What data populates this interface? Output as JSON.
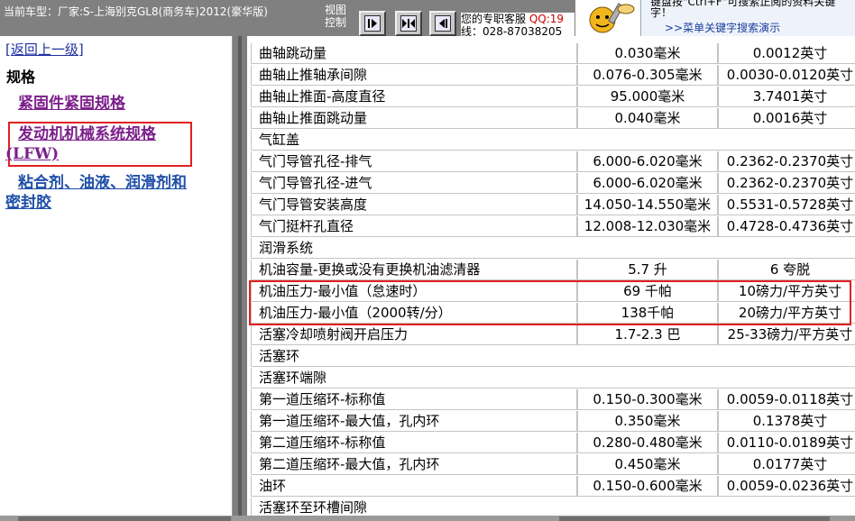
{
  "header": {
    "vehicle_label": "当前车型：厂家:S-上海别克GL8(商务车)2012(豪华版)",
    "view_control_label": "视图控制",
    "nav_buttons": [
      "first",
      "expand",
      "previous"
    ],
    "support_label": "您的专职客服",
    "support_qq": "QQ:19",
    "support_phone": "线：028-87038205",
    "tips_line1": "键盘按\"Ctrl+F\"可搜索正阅的资料关键",
    "tips_line2": "字！",
    "tips_link": ">>菜单关键字搜索演示"
  },
  "sidebar": {
    "back_link": "[返回上一级]",
    "section_title": "规格",
    "items": [
      {
        "label": "紧固件紧固规格"
      },
      {
        "label_line1": "发动机机械系统规格",
        "label_line2": "(LFW)"
      },
      {
        "label_line1": "粘合剂、油液、润滑剂和",
        "label_line2": "密封胶"
      }
    ]
  },
  "table": {
    "rows": [
      {
        "name": "曲轴跳动量",
        "metric": "0.030毫米",
        "imperial": "0.0012英寸"
      },
      {
        "name": "曲轴止推轴承间隙",
        "metric": "0.076-0.305毫米",
        "imperial": "0.0030-0.0120英寸"
      },
      {
        "name": "曲轴止推面-高度直径",
        "metric": "95.000毫米",
        "imperial": "3.7401英寸"
      },
      {
        "name": "曲轴止推面跳动量",
        "metric": "0.040毫米",
        "imperial": "0.0016英寸"
      },
      {
        "name": "气缸盖",
        "section": true
      },
      {
        "name": "气门导管孔径-排气",
        "metric": "6.000-6.020毫米",
        "imperial": "0.2362-0.2370英寸"
      },
      {
        "name": "气门导管孔径-进气",
        "metric": "6.000-6.020毫米",
        "imperial": "0.2362-0.2370英寸"
      },
      {
        "name": "气门导管安装高度",
        "metric": "14.050-14.550毫米",
        "imperial": "0.5531-0.5728英寸"
      },
      {
        "name": "气门挺杆孔直径",
        "metric": "12.008-12.030毫米",
        "imperial": "0.4728-0.4736英寸"
      },
      {
        "name": "润滑系统",
        "section": true
      },
      {
        "name": "机油容量-更换或没有更换机油滤清器",
        "metric": "5.7 升",
        "imperial": "6 夸脱"
      },
      {
        "name": "机油压力-最小值（怠速时）",
        "metric": "69 千帕",
        "imperial": "10磅力/平方英寸"
      },
      {
        "name": "机油压力-最小值（2000转/分）",
        "metric": "138千帕",
        "imperial": "20磅力/平方英寸"
      },
      {
        "name": "活塞冷却喷射阀开启压力",
        "metric": "1.7-2.3 巴",
        "imperial": "25-33磅力/平方英寸"
      },
      {
        "name": "活塞环",
        "section": true
      },
      {
        "name": "活塞环端隙",
        "section": true
      },
      {
        "name": "第一道压缩环-标称值",
        "metric": "0.150-0.300毫米",
        "imperial": "0.0059-0.0118英寸"
      },
      {
        "name": "第一道压缩环-最大值，孔内环",
        "metric": "0.350毫米",
        "imperial": "0.1378英寸"
      },
      {
        "name": "第二道压缩环-标称值",
        "metric": "0.280-0.480毫米",
        "imperial": "0.0110-0.0189英寸"
      },
      {
        "name": "第二道压缩环-最大值，孔内环",
        "metric": "0.450毫米",
        "imperial": "0.0177英寸"
      },
      {
        "name": "油环",
        "metric": "0.150-0.600毫米",
        "imperial": "0.0059-0.0236英寸"
      },
      {
        "name": "活塞环至环槽间隙",
        "section": true
      }
    ]
  },
  "colors": {
    "highlight": "#e02020",
    "visited_link": "#7b1f8a",
    "link": "#1f4fa8"
  }
}
